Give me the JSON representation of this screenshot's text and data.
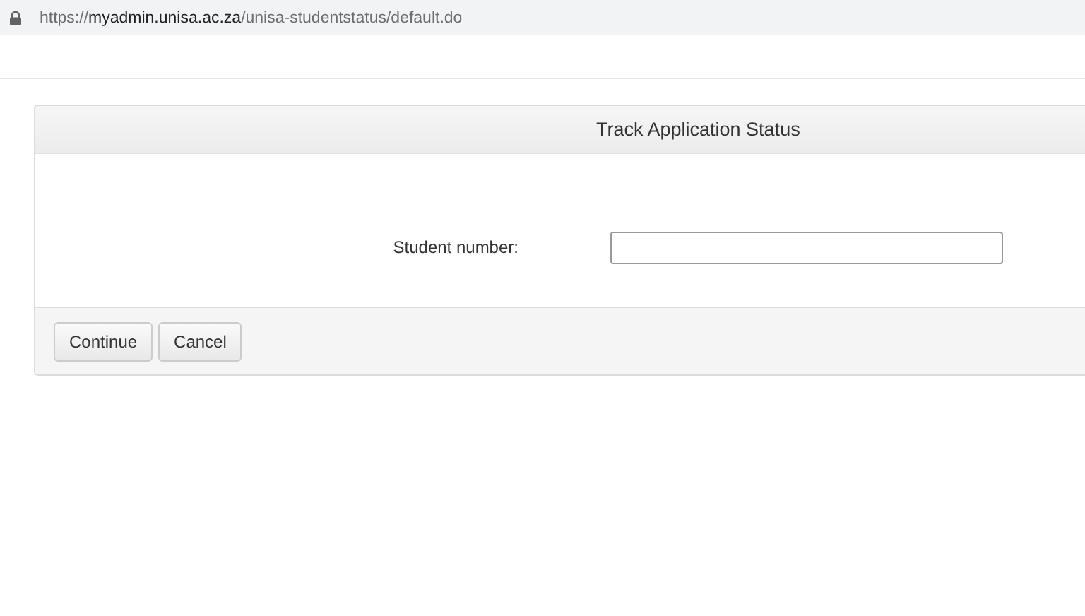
{
  "address_bar": {
    "scheme": "https://",
    "host": "myadmin.unisa.ac.za",
    "path": "/unisa-studentstatus/default.do"
  },
  "panel": {
    "title": "Track Application Status",
    "fields": [
      {
        "label": "Student number:"
      }
    ],
    "buttons": [
      "Continue",
      "Cancel"
    ]
  }
}
